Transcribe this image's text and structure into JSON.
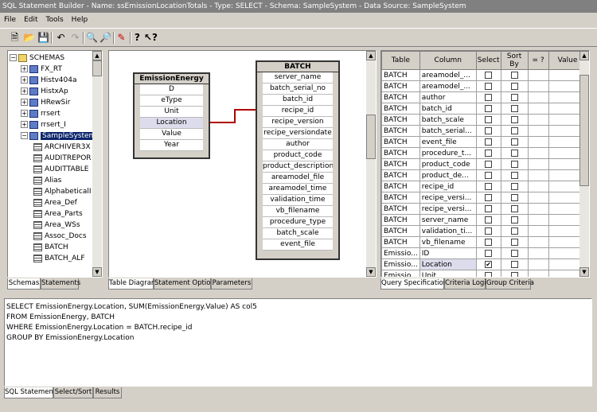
{
  "window": {
    "title": "SQL Statement Builder - Name: ssEmissionLocationTotals - Type: SELECT - Schema: SampleSystem - Data Source: SampleSystem"
  },
  "menu": [
    "File",
    "Edit",
    "Tools",
    "Help"
  ],
  "toolbar": [
    "new-icon",
    "open-icon",
    "save-icon",
    "undo-icon",
    "redo-icon",
    "zoom-in-icon",
    "zoom-out-icon",
    "validate-icon",
    "help-icon",
    "context-help-icon"
  ],
  "tree": {
    "root": "SCHEMAS",
    "items": [
      "FX_RT",
      "Histv404a",
      "HistxAp",
      "HRewSir",
      "rrsert",
      "rrsert_I",
      "SampleSystem"
    ],
    "children": [
      "ARCHIVER3X",
      "AUDITREPOR",
      "AUDITTABLE",
      "Alias",
      "AlphabeticalI",
      "Area_Def",
      "Area_Parts",
      "Area_WSs",
      "Assoc_Docs",
      "BATCH",
      "BATCH_ALF"
    ]
  },
  "left_tabs": [
    "Schemas",
    "Statements"
  ],
  "diagram": {
    "tables": [
      {
        "name": "EmissionEnergy",
        "fields": [
          "D",
          "eType",
          "Unit",
          "Location",
          "Value",
          "Year"
        ]
      },
      {
        "name": "BATCH",
        "fields": [
          "server_name",
          "batch_serial_no",
          "batch_id",
          "recipe_id",
          "recipe_version",
          "recipe_versiondate",
          "author",
          "product_code",
          "product_description",
          "areamodel_file",
          "areamodel_time",
          "validation_time",
          "vb_filename",
          "procedure_type",
          "batch_scale",
          "event_file"
        ]
      }
    ]
  },
  "middle_tabs": [
    "Table Diagram",
    "Statement Options",
    "Parameters"
  ],
  "grid": {
    "headers": [
      "Table",
      "Column",
      "Select",
      "Sort By",
      "= ?",
      "Value"
    ],
    "rows": [
      {
        "table": "BATCH",
        "column": "areamodel_...",
        "select": false
      },
      {
        "table": "BATCH",
        "column": "areamodel_...",
        "select": false
      },
      {
        "table": "BATCH",
        "column": "author",
        "select": false
      },
      {
        "table": "BATCH",
        "column": "batch_id",
        "select": false
      },
      {
        "table": "BATCH",
        "column": "batch_scale",
        "select": false
      },
      {
        "table": "BATCH",
        "column": "batch_serial...",
        "select": false
      },
      {
        "table": "BATCH",
        "column": "event_file",
        "select": false
      },
      {
        "table": "BATCH",
        "column": "procedure_t...",
        "select": false
      },
      {
        "table": "BATCH",
        "column": "product_code",
        "select": false
      },
      {
        "table": "BATCH",
        "column": "product_de...",
        "select": false
      },
      {
        "table": "BATCH",
        "column": "recipe_id",
        "select": false
      },
      {
        "table": "BATCH",
        "column": "recipe_versi...",
        "select": false
      },
      {
        "table": "BATCH",
        "column": "recipe_versi...",
        "select": false
      },
      {
        "table": "BATCH",
        "column": "server_name",
        "select": false
      },
      {
        "table": "BATCH",
        "column": "validation_ti...",
        "select": false
      },
      {
        "table": "BATCH",
        "column": "vb_filename",
        "select": false
      },
      {
        "table": "Emissio...",
        "column": "ID",
        "select": false
      },
      {
        "table": "Emissio...",
        "column": "Location",
        "select": true
      },
      {
        "table": "Emissio...",
        "column": "Unit",
        "select": false
      }
    ]
  },
  "right_tabs": [
    "Query Specification",
    "Criteria Logic",
    "Group Criteria"
  ],
  "sql": {
    "lines": [
      "SELECT EmissionEnergy.Location, SUM(EmissionEnergy.Value) AS col5",
      "FROM EmissionEnergy, BATCH",
      "WHERE EmissionEnergy.Location = BATCH.recipe_id",
      "GROUP BY EmissionEnergy.Location"
    ]
  },
  "bottom_tabs": [
    "SQL Statement",
    "Select/Sort",
    "Results"
  ]
}
